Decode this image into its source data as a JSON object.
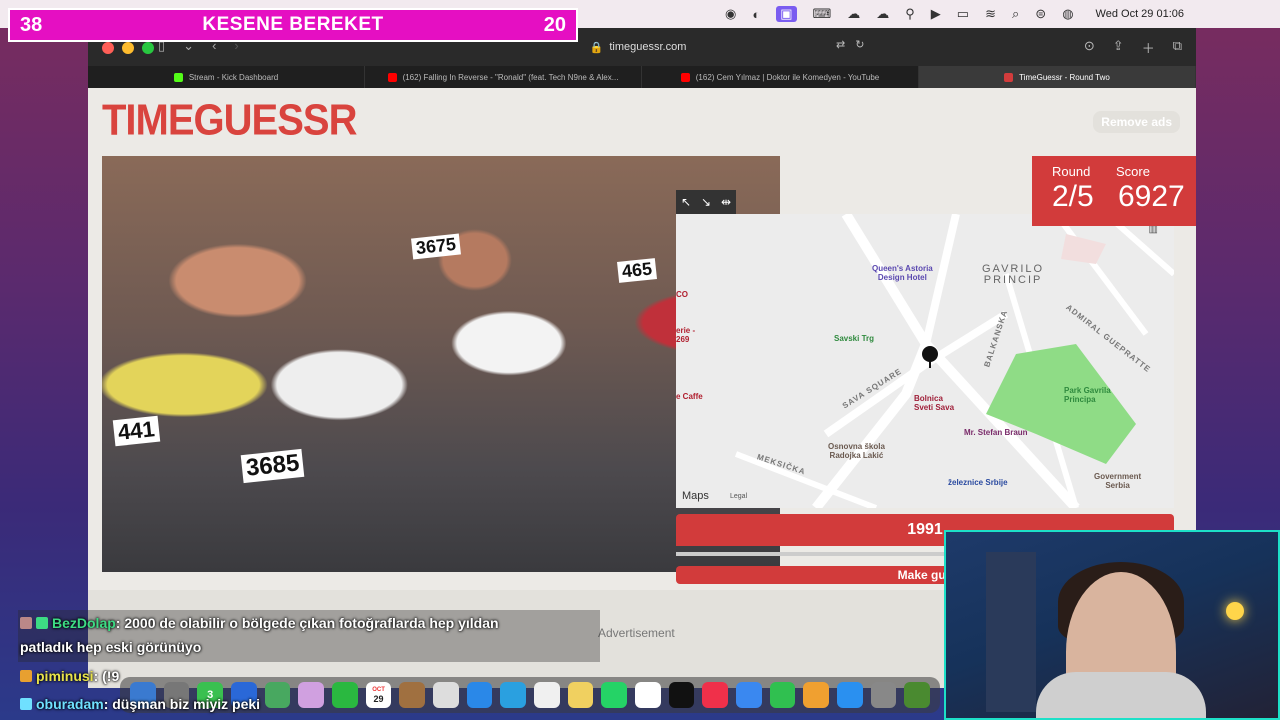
{
  "menubar": {
    "clock": "Wed Oct 29  01:06"
  },
  "overlay": {
    "left_count": "38",
    "title": "KESENE BEREKET",
    "right_count": "20"
  },
  "browser": {
    "url": "timeguessr.com",
    "tabs": [
      {
        "label": "Stream - Kick Dashboard",
        "favicon": "kick"
      },
      {
        "label": "(162) Falling In Reverse - \"Ronald\" (feat. Tech N9ne & Alex...",
        "favicon": "youtube"
      },
      {
        "label": "(162) Cem Yılmaz | Doktor ile Komedyen - YouTube",
        "favicon": "youtube"
      },
      {
        "label": "TimeGuessr - Round Two",
        "favicon": "timeguessr"
      }
    ]
  },
  "page": {
    "logo": "TIMEGUESSR",
    "remove_ads": "Remove ads",
    "round_label": "Round",
    "round_value": "2/5",
    "score_label": "Score",
    "score_value": "6927",
    "year": "1991",
    "make_guess": "Make gue",
    "advertisement": "Advertisement",
    "photo_bibs": [
      "3675",
      "3685",
      "441",
      "465"
    ]
  },
  "map": {
    "labels": {
      "queens": "Queen's Astoria\nDesign Hotel",
      "district": "GAVRILO\nPRINCIP",
      "savski": "Savski Trg",
      "park": "Park Gavrila\nPrincipa",
      "bolnica": "Bolnica\nSveti Sava",
      "braun": "Mr. Stefan Braun",
      "skola": "Osnovna škola\nRadojka Lakić",
      "zeleznice": "železnice Srbije",
      "government": "Government\nSerbia",
      "sava_square": "SAVA SQUARE",
      "balkanska": "BALKANSKA",
      "admiral": "ADMIRAL GUEPRATTE",
      "meksicka": "MEKSIČKA",
      "edge1": "CO",
      "edge2": "erie -\n269",
      "edge3": "e Caffe",
      "maps": "Maps",
      "legal": "Legal"
    }
  },
  "chat": [
    {
      "user": "BezDolap",
      "message": ": 2000 de olabilir o bölgede çıkan fotoğraflarda hep yıldan",
      "cont": "patladık hep eski görünüyo"
    },
    {
      "user": "piminusi",
      "message": ": (!9"
    },
    {
      "user": "oburadam",
      "message": ": düşman biz miyiz peki"
    }
  ],
  "dock": {
    "calendar_day": "29",
    "calendar_month": "OCT",
    "mail_badge": "3"
  }
}
